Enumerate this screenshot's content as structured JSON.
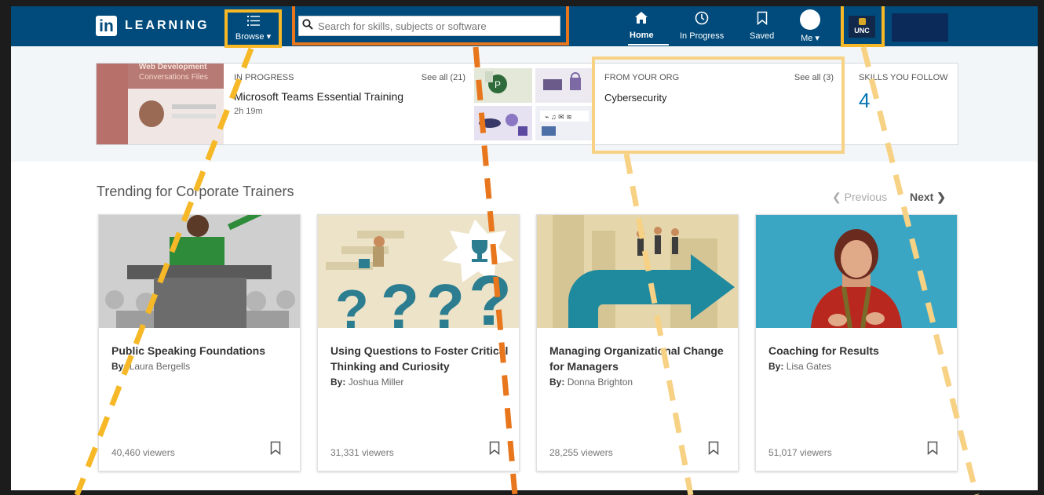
{
  "nav": {
    "logo_word": "LEARNING",
    "browse_label": "Browse ▾",
    "search_placeholder": "Search for skills, subjects or software",
    "home_label": "Home",
    "progress_label": "In Progress",
    "saved_label": "Saved",
    "me_label": "Me ▾",
    "org_logo_text": "UNC"
  },
  "strip": {
    "thumb_header": "Web Development",
    "thumb_sub": "Conversations  Files",
    "in_progress_caption": "IN PROGRESS",
    "in_progress_seeall": "See all (21)",
    "in_progress_title": "Microsoft Teams Essential Training",
    "in_progress_duration": "2h 19m",
    "org_caption": "FROM YOUR ORG",
    "org_seeall": "See all (3)",
    "org_title": "Cybersecurity",
    "skills_caption": "SKILLS YOU FOLLOW",
    "skills_count": "4"
  },
  "trending": {
    "title": "Trending for Corporate Trainers",
    "previous": "❮  Previous",
    "next": "Next  ❯",
    "cards": [
      {
        "title": "Public Speaking Foundations",
        "by": "By:",
        "author": "Laura Bergells",
        "viewers": "40,460 viewers"
      },
      {
        "title": "Using Questions to Foster Critical Thinking and Curiosity",
        "by": "By:",
        "author": "Joshua Miller",
        "viewers": "31,331 viewers"
      },
      {
        "title": "Managing Organizational Change for Managers",
        "by": "By:",
        "author": "Donna Brighton",
        "viewers": "28,255 viewers"
      },
      {
        "title": "Coaching for Results",
        "by": "By:",
        "author": "Lisa Gates",
        "viewers": "51,017 viewers"
      }
    ]
  },
  "colors": {
    "nav_bg": "#004b7c",
    "highlight_yellow": "#f6b826",
    "highlight_orange": "#e8761c",
    "highlight_pale": "#f7d184",
    "link_blue": "#0073b1"
  }
}
